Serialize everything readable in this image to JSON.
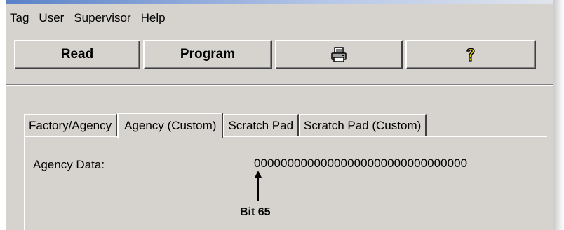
{
  "menu": {
    "items": [
      {
        "label": "Tag"
      },
      {
        "label": "User"
      },
      {
        "label": "Supervisor"
      },
      {
        "label": "Help"
      }
    ]
  },
  "toolbar": {
    "read_label": "Read",
    "program_label": "Program",
    "print_icon": "printer-icon",
    "help_icon": "question-mark-icon"
  },
  "tabs": [
    {
      "label": "Factory/Agency",
      "active": false
    },
    {
      "label": "Agency (Custom)",
      "active": true
    },
    {
      "label": "Scratch Pad",
      "active": false
    },
    {
      "label": "Scratch Pad (Custom)",
      "active": false
    }
  ],
  "agency": {
    "label": "Agency Data:",
    "value": "00000000000000000000000000000000",
    "bit_marker": "Bit 65"
  },
  "colors": {
    "window_bg": "#d6d3ce",
    "title_strip": "#5a82c8",
    "help_icon_yellow": "#f0e000"
  }
}
